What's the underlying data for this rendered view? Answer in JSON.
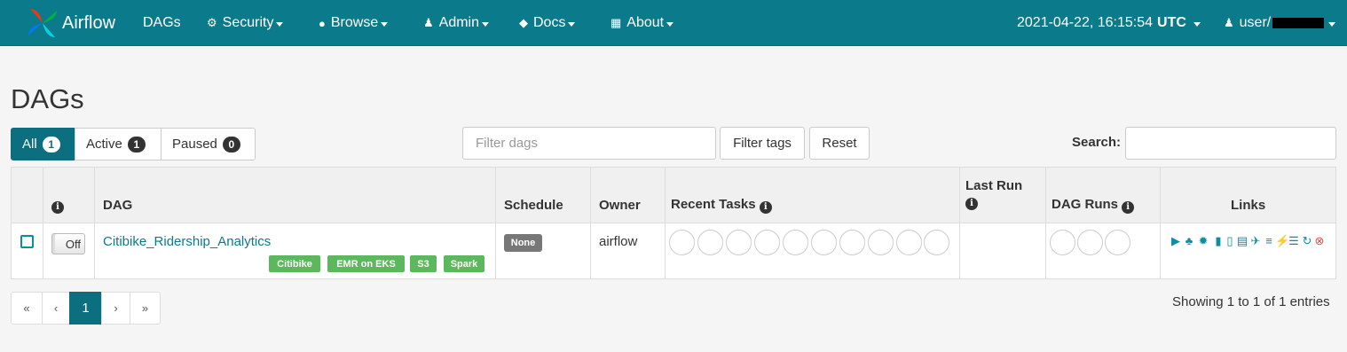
{
  "navbar": {
    "brand": "Airflow",
    "items": [
      {
        "label": "DAGs",
        "icon": "none",
        "caret": false
      },
      {
        "label": "Security",
        "icon": "cogs-icon",
        "caret": true
      },
      {
        "label": "Browse",
        "icon": "globe-icon",
        "caret": true
      },
      {
        "label": "Admin",
        "icon": "user-icon",
        "caret": true
      },
      {
        "label": "Docs",
        "icon": "cube-icon",
        "caret": true
      },
      {
        "label": "About",
        "icon": "grid-icon",
        "caret": true
      }
    ],
    "datetime": "2021-04-22, 16:15:54",
    "timezone": "UTC",
    "user": "user/",
    "bg_color": "#0b7a8a"
  },
  "page": {
    "title": "DAGs"
  },
  "filters": {
    "all": {
      "label": "All",
      "count": "1"
    },
    "active": {
      "label": "Active",
      "count": "1"
    },
    "paused": {
      "label": "Paused",
      "count": "0"
    },
    "filter_placeholder": "Filter dags",
    "filter_tags_label": "Filter tags",
    "reset_label": "Reset",
    "search_label": "Search:"
  },
  "table": {
    "headers": {
      "info": "i",
      "dag": "DAG",
      "schedule": "Schedule",
      "owner": "Owner",
      "recent_tasks": "Recent Tasks",
      "last_run": "Last Run",
      "dag_runs": "DAG Runs",
      "links": "Links"
    },
    "rows": [
      {
        "toggle": "Off",
        "dag_id": "Citibike_Ridership_Analytics",
        "tags": [
          "Citibike",
          "EMR on EKS",
          "S3",
          "Spark"
        ],
        "schedule": "None",
        "owner": "airflow",
        "last_run": ""
      }
    ]
  },
  "pagination": {
    "first": "«",
    "prev": "‹",
    "current": "1",
    "next": "›",
    "last": "»",
    "summary": "Showing 1 to 1 of 1 entries"
  },
  "colors": {
    "accent": "#0b6f7f",
    "tag": "#5cb85c",
    "link": "#0b8fa0",
    "delete": "#d9534f"
  }
}
